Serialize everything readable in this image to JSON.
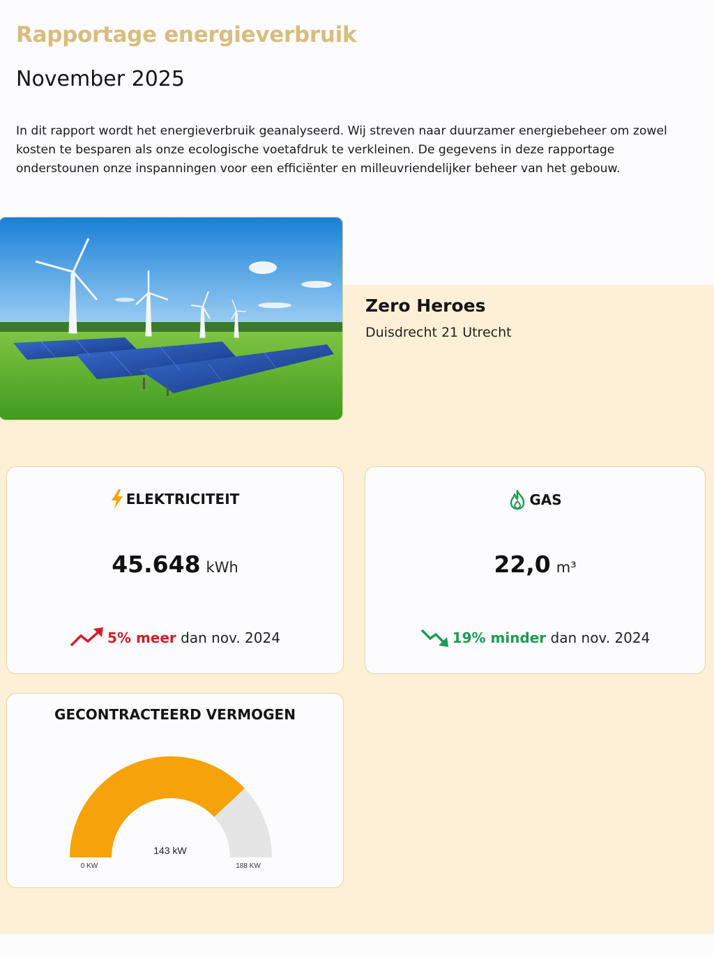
{
  "header": {
    "title": "Rapportage energieverbruik",
    "period": "November 2025",
    "intro": "In dit rapport wordt het energieverbruik geanalyseerd. Wij streven naar duurzamer energiebeheer om zowel kosten te besparen als onze ecologische voetafdruk te verkleinen. De gegevens in deze rapportage onderstounen onze inspanningen voor een efficiënter en milleuvriendelijker beheer van het gebouw."
  },
  "location": {
    "name": "Zero Heroes",
    "address": "Duisdrecht 21 Utrecht"
  },
  "electricity": {
    "label": "ELEKTRICITEIT",
    "icon": "lightning-icon",
    "value": "45.648",
    "unit": "kWh",
    "change": "5% meer",
    "change_suffix": "dan nov. 2024",
    "trend_icon": "trend-up-icon",
    "trend_color": "#d01f2a"
  },
  "gas": {
    "label": "GAS",
    "icon": "flame-icon",
    "value": "22,0",
    "unit": "m³",
    "change": "19% minder",
    "change_suffix": "dan nov. 2024",
    "trend_icon": "trend-down-icon",
    "trend_color": "#1e9a52"
  },
  "contracted_power": {
    "title": "GECONTRACTEERD VERMOGEN",
    "value_label": "143 kW",
    "min_label": "0 KW",
    "max_label": "188 KW",
    "value": 143,
    "min": 0,
    "max": 188,
    "fill_color": "#f6a20a",
    "track_color": "#e5e5e5"
  },
  "colors": {
    "accent": "#d8bd7e",
    "band": "#fdf0d6"
  }
}
